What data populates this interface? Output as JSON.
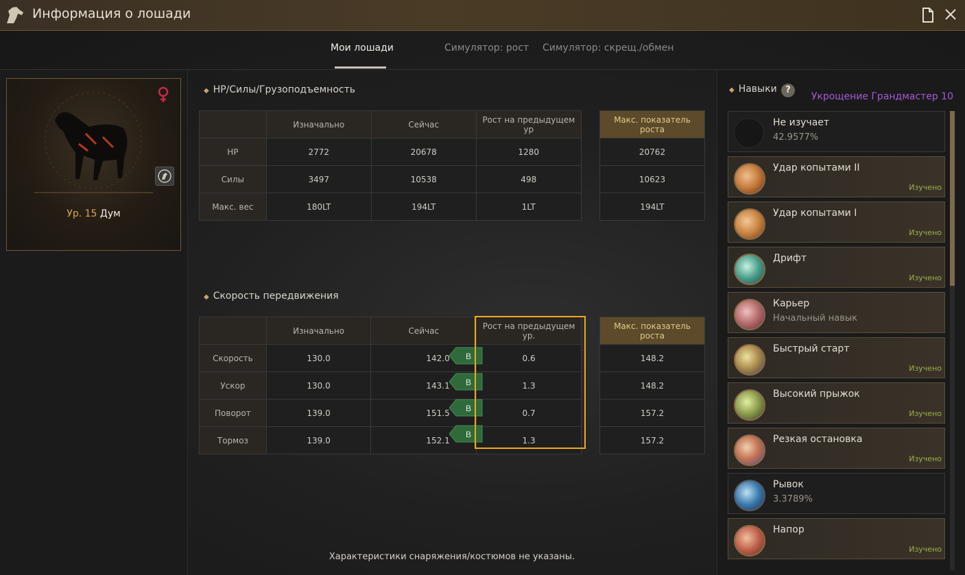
{
  "window": {
    "title": "Информация о лошади"
  },
  "tabs": [
    {
      "label": "Мои лошади"
    },
    {
      "label": "Симулятор: рост"
    },
    {
      "label": "Симулятор: скрещ./обмен"
    }
  ],
  "horse": {
    "level_label": "Ур. 15",
    "name": "Дум"
  },
  "stats1": {
    "title": "HP/Силы/Грузоподъемность",
    "headers": [
      "Изначально",
      "Сейчас",
      "Рост на предыдущем ур"
    ],
    "max_header": "Макс. показатель роста",
    "rows": [
      {
        "label": "HP",
        "initial": "2772",
        "current": "20678",
        "growth": "1280",
        "max": "20762"
      },
      {
        "label": "Силы",
        "initial": "3497",
        "current": "10538",
        "growth": "498",
        "max": "10623"
      },
      {
        "label": "Макс. вес",
        "initial": "180LT",
        "current": "194LT",
        "growth": "1LT",
        "max": "194LT"
      }
    ]
  },
  "stats2": {
    "title": "Скорость передвижения",
    "headers": [
      "Изначально",
      "Сейчас",
      "Рост на предыдущем ур."
    ],
    "max_header": "Макс. показатель роста",
    "rows": [
      {
        "label": "Скорость",
        "initial": "130.0",
        "current": "142.0",
        "grade": "B",
        "growth": "0.6",
        "max": "148.2"
      },
      {
        "label": "Ускор",
        "initial": "130.0",
        "current": "143.1",
        "grade": "B",
        "growth": "1.3",
        "max": "148.2"
      },
      {
        "label": "Поворот",
        "initial": "139.0",
        "current": "151.5",
        "grade": "B",
        "growth": "0.7",
        "max": "157.2"
      },
      {
        "label": "Тормоз",
        "initial": "139.0",
        "current": "152.1",
        "grade": "B",
        "growth": "1.3",
        "max": "157.2"
      }
    ]
  },
  "footer": "Характеристики снаряжения/костюмов не указаны.",
  "skills": {
    "title": "Навыки",
    "help": "?",
    "mastery": "Укрощение Грандмастер 10",
    "items": [
      {
        "name": "Не изучает",
        "sub": "42.9577%",
        "status": "",
        "learned": false,
        "color": "#1a1a1a"
      },
      {
        "name": "Удар копытами II",
        "sub": "",
        "status": "Изучено",
        "learned": true,
        "color": "#c47a3a"
      },
      {
        "name": "Удар копытами I",
        "sub": "",
        "status": "Изучено",
        "learned": true,
        "color": "#c9843f"
      },
      {
        "name": "Дрифт",
        "sub": "",
        "status": "Изучено",
        "learned": true,
        "color": "#4a9c8a"
      },
      {
        "name": "Карьер",
        "sub": "Начальный навык",
        "status": "",
        "learned": true,
        "color": "#b36a6a"
      },
      {
        "name": "Быстрый старт",
        "sub": "",
        "status": "Изучено",
        "learned": true,
        "color": "#a88a4a"
      },
      {
        "name": "Высокий прыжок",
        "sub": "",
        "status": "Изучено",
        "learned": true,
        "color": "#8a9a4a"
      },
      {
        "name": "Резкая остановка",
        "sub": "",
        "status": "Изучено",
        "learned": true,
        "color": "#c07050"
      },
      {
        "name": "Рывок",
        "sub": "3.3789%",
        "status": "",
        "learned": false,
        "color": "#3a7ab0"
      },
      {
        "name": "Напор",
        "sub": "",
        "status": "Изучено",
        "learned": true,
        "color": "#c0604a"
      }
    ]
  }
}
